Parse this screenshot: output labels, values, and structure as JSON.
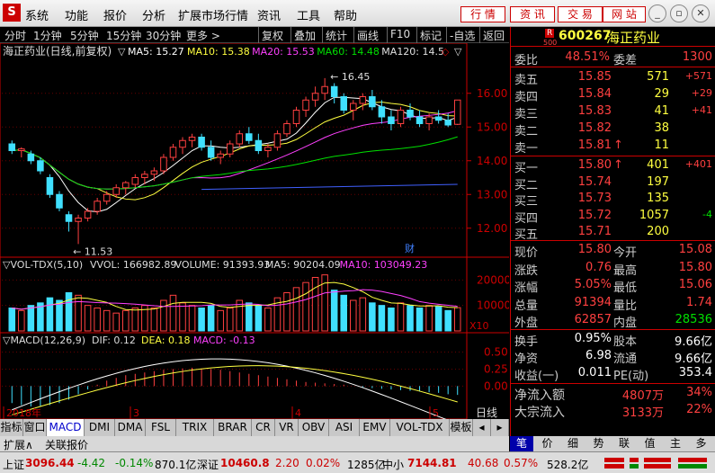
{
  "menu": {
    "items": [
      "系统",
      "功能",
      "报价",
      "分析",
      "扩展市场行情",
      "资讯",
      "工具",
      "帮助"
    ],
    "right_buttons": [
      "行 情",
      "资 讯",
      "交 易",
      "网 站"
    ]
  },
  "toolbar": {
    "left": [
      "分时",
      "1分钟",
      "5分钟",
      "15分钟",
      "30分钟",
      "更多 >"
    ],
    "right": [
      "复权",
      "叠加",
      "统计",
      "画线",
      "F10",
      "标记",
      "-自选",
      "返回"
    ]
  },
  "main": {
    "title": "海正药业(日线,前复权)",
    "ma_labels": [
      {
        "t": "MA5: 15.27",
        "c": "#ffffff"
      },
      {
        "t": "MA10: 15.38",
        "c": "#ffff40"
      },
      {
        "t": "MA20: 15.53",
        "c": "#ff40ff"
      },
      {
        "t": "MA60: 14.48",
        "c": "#00e000"
      },
      {
        "t": "MA120: 14.5",
        "c": "#e0e0e0"
      }
    ],
    "yticks": [
      "16.00",
      "15.00",
      "14.00",
      "13.00",
      "12.00"
    ],
    "high_mark": "16.45",
    "low_mark": "11.53",
    "cai_mark": "财"
  },
  "volume": {
    "title": "VOL-TDX(5,10)",
    "vvol": "VVOL: 166982.89",
    "volume": "VOLUME: 91393.93",
    "ma5": "MA5: 90204.09",
    "ma10": "MA10: 103049.23",
    "yticks": [
      "20000",
      "10000"
    ],
    "unit": "X10"
  },
  "macd": {
    "title": "MACD(12,26,9)",
    "dif": "DIF: 0.12",
    "dea": "DEA: 0.18",
    "macd": "MACD: -0.13",
    "yticks": [
      "0.50",
      "0.25",
      "0.00"
    ]
  },
  "xaxis": {
    "labels": [
      "2018年",
      "3",
      "4",
      "5"
    ],
    "mode": "日线"
  },
  "bottom_tabs": [
    "指标",
    "窗口",
    "MACD",
    "DMI",
    "DMA",
    "FSL",
    "TRIX",
    "BRAR",
    "CR",
    "VR",
    "OBV",
    "ASI",
    "EMV",
    "VOL-TDX",
    "模板"
  ],
  "ext": {
    "label": "扩展∧",
    "report": "关联报价"
  },
  "quote": {
    "code": "600267",
    "name": "海正药业",
    "badge": "R",
    "badge2": "500",
    "weibi_label": "委比",
    "weibi": "48.51%",
    "weicha_label": "委差",
    "weicha": "1300",
    "sells": [
      {
        "l": "卖五",
        "p": "15.85",
        "v": "571",
        "c": "+571"
      },
      {
        "l": "卖四",
        "p": "15.84",
        "v": "29",
        "c": "+29"
      },
      {
        "l": "卖三",
        "p": "15.83",
        "v": "41",
        "c": "+41"
      },
      {
        "l": "卖二",
        "p": "15.82",
        "v": "38",
        "c": ""
      },
      {
        "l": "卖一",
        "p": "15.81",
        "v": "11",
        "c": "",
        "arrow": "↑"
      }
    ],
    "buys": [
      {
        "l": "买一",
        "p": "15.80",
        "v": "401",
        "c": "+401",
        "arrow": "↑"
      },
      {
        "l": "买二",
        "p": "15.74",
        "v": "197",
        "c": ""
      },
      {
        "l": "买三",
        "p": "15.73",
        "v": "135",
        "c": ""
      },
      {
        "l": "买四",
        "p": "15.72",
        "v": "1057",
        "c": "-4"
      },
      {
        "l": "买五",
        "p": "15.71",
        "v": "200",
        "c": ""
      }
    ],
    "stats": [
      [
        "现价",
        "15.80",
        "今开",
        "15.08"
      ],
      [
        "涨跌",
        "0.76",
        "最高",
        "15.80"
      ],
      [
        "涨幅",
        "5.05%",
        "最低",
        "15.06"
      ],
      [
        "总量",
        "91394",
        "量比",
        "1.74"
      ],
      [
        "外盘",
        "62857",
        "内盘",
        "28536"
      ]
    ],
    "stats2": [
      [
        "换手",
        "0.95%",
        "股本",
        "9.66亿"
      ],
      [
        "净资",
        "6.98",
        "流通",
        "9.66亿"
      ],
      [
        "收益(一)",
        "0.011",
        "PE(动)",
        "353.4"
      ]
    ],
    "flow": [
      [
        "净流入额",
        "4807万",
        "34%"
      ],
      [
        "大宗流入",
        "3133万",
        "22%"
      ]
    ],
    "tabs": [
      "笔",
      "价",
      "细",
      "势",
      "联",
      "值",
      "主",
      "多"
    ]
  },
  "status": {
    "sh_label": "上证",
    "sh": "3096.44",
    "sh_chg": "-4.42",
    "sh_pct": "-0.14%",
    "sh_amt": "870.1亿",
    "sz_label": "深证",
    "sz": "10460.8",
    "sz_chg": "2.20",
    "sz_pct": "0.02%",
    "sz_amt": "1285亿",
    "zx_label": "中小",
    "zx": "7144.81",
    "zx_chg": "40.68",
    "zx_pct": "0.57%",
    "zx_amt": "528.2亿"
  },
  "chart_data": {
    "type": "candlestick",
    "ohlc": [
      [
        14.5,
        14.6,
        14.2,
        14.3
      ],
      [
        14.3,
        14.4,
        14.1,
        14.35
      ],
      [
        14.2,
        14.3,
        13.9,
        14.0
      ],
      [
        14.0,
        14.1,
        13.6,
        13.7
      ],
      [
        13.5,
        13.6,
        12.9,
        13.0
      ],
      [
        13.0,
        13.1,
        12.5,
        12.6
      ],
      [
        12.4,
        12.5,
        11.9,
        12.2
      ],
      [
        12.2,
        12.4,
        11.53,
        12.3
      ],
      [
        12.3,
        12.6,
        12.2,
        12.5
      ],
      [
        12.5,
        12.9,
        12.4,
        12.8
      ],
      [
        12.8,
        13.1,
        12.7,
        13.0
      ],
      [
        13.0,
        13.3,
        12.9,
        13.2
      ],
      [
        13.2,
        13.4,
        13.0,
        13.35
      ],
      [
        13.3,
        13.6,
        13.2,
        13.5
      ],
      [
        13.5,
        13.7,
        13.3,
        13.6
      ],
      [
        13.6,
        13.8,
        13.4,
        13.7
      ],
      [
        13.7,
        14.2,
        13.6,
        14.1
      ],
      [
        14.1,
        14.5,
        14.0,
        14.4
      ],
      [
        14.4,
        14.7,
        14.2,
        14.6
      ],
      [
        14.6,
        14.8,
        14.4,
        14.7
      ],
      [
        14.7,
        14.8,
        14.3,
        14.4
      ],
      [
        14.4,
        14.6,
        14.0,
        14.1
      ],
      [
        14.1,
        14.3,
        13.9,
        14.2
      ],
      [
        14.2,
        14.6,
        14.1,
        14.5
      ],
      [
        14.5,
        14.9,
        14.4,
        14.8
      ],
      [
        14.8,
        15.0,
        14.5,
        14.6
      ],
      [
        14.6,
        14.8,
        14.2,
        14.3
      ],
      [
        14.3,
        14.5,
        14.1,
        14.4
      ],
      [
        14.4,
        14.9,
        14.3,
        14.8
      ],
      [
        14.8,
        15.2,
        14.7,
        15.1
      ],
      [
        15.1,
        15.6,
        15.0,
        15.5
      ],
      [
        15.5,
        15.9,
        15.3,
        15.8
      ],
      [
        15.8,
        16.2,
        15.6,
        16.0
      ],
      [
        16.0,
        16.45,
        15.8,
        16.2
      ],
      [
        16.2,
        16.3,
        15.7,
        15.9
      ],
      [
        15.9,
        16.0,
        15.4,
        15.5
      ],
      [
        15.5,
        15.8,
        15.2,
        15.7
      ],
      [
        15.7,
        16.0,
        15.5,
        15.9
      ],
      [
        15.9,
        16.1,
        15.5,
        15.6
      ],
      [
        15.6,
        15.8,
        15.1,
        15.3
      ],
      [
        15.3,
        15.5,
        14.9,
        15.1
      ],
      [
        15.1,
        15.6,
        15.0,
        15.5
      ],
      [
        15.5,
        15.7,
        15.2,
        15.3
      ],
      [
        15.3,
        15.5,
        15.0,
        15.1
      ],
      [
        15.1,
        15.4,
        14.9,
        15.3
      ],
      [
        15.3,
        15.5,
        15.1,
        15.2
      ],
      [
        15.2,
        15.4,
        15.0,
        15.06
      ],
      [
        15.08,
        15.8,
        15.06,
        15.8
      ]
    ],
    "volume": [
      9000,
      8000,
      10000,
      11000,
      13000,
      12000,
      15000,
      14000,
      10000,
      9000,
      8000,
      7000,
      8000,
      9000,
      10000,
      9000,
      12000,
      14000,
      11000,
      10000,
      9000,
      10000,
      8000,
      9000,
      12000,
      11000,
      10000,
      9000,
      13000,
      15000,
      17000,
      19000,
      21000,
      22000,
      16000,
      14000,
      12000,
      13000,
      11000,
      10000,
      9000,
      11000,
      10000,
      9000,
      10000,
      9500,
      8000,
      9139
    ],
    "macd_hist": [
      -0.25,
      -0.28,
      -0.3,
      -0.3,
      -0.28,
      -0.25,
      -0.2,
      -0.12,
      -0.05,
      0.02,
      0.08,
      0.12,
      0.16,
      0.18,
      0.2,
      0.22,
      0.24,
      0.25,
      0.26,
      0.27,
      0.26,
      0.25,
      0.24,
      0.22,
      0.2,
      0.18,
      0.16,
      0.14,
      0.12,
      0.1,
      0.08,
      0.06,
      0.05,
      0.04,
      0.03,
      0.02,
      0.0,
      -0.02,
      -0.03,
      -0.04,
      -0.05,
      -0.06,
      -0.07,
      -0.08,
      -0.09,
      -0.1,
      -0.12,
      -0.13
    ],
    "yrange": [
      11.3,
      16.9
    ]
  }
}
